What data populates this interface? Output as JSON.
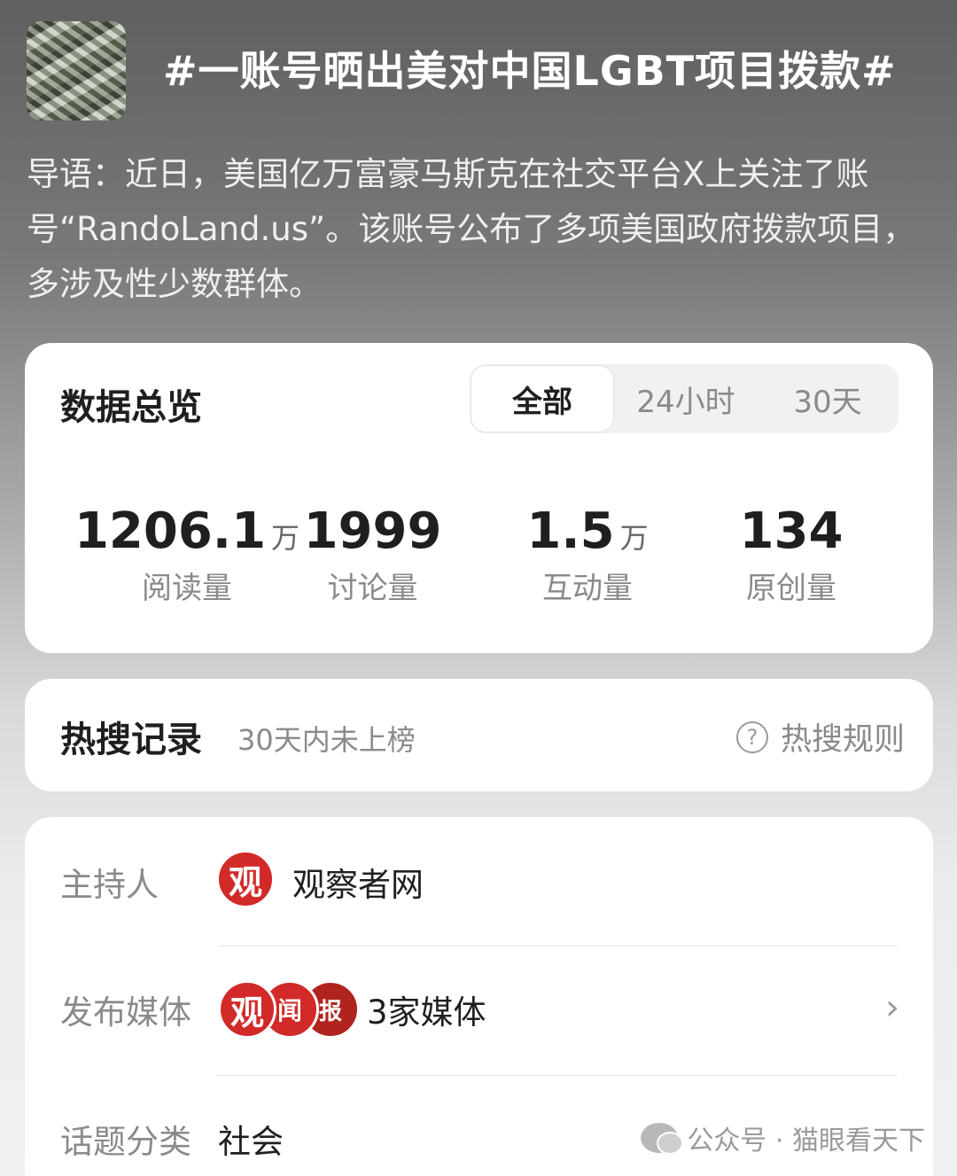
{
  "topic": {
    "title": "#一账号晒出美对中国LGBT项目拨款#",
    "intro": "导语：近日，美国亿万富豪马斯克在社交平台X上关注了账号“RandoLand.us”。该账号公布了多项美国政府拨款项目，多涉及性少数群体。"
  },
  "overview": {
    "title": "数据总览",
    "tabs": [
      "全部",
      "24小时",
      "30天"
    ],
    "active_tab": "全部",
    "stats": [
      {
        "value": "1206.1",
        "unit": "万",
        "label": "阅读量"
      },
      {
        "value": "1999",
        "unit": "",
        "label": "讨论量"
      },
      {
        "value": "1.5",
        "unit": "万",
        "label": "互动量"
      },
      {
        "value": "134",
        "unit": "",
        "label": "原创量"
      }
    ]
  },
  "hot_search": {
    "title": "热搜记录",
    "subtitle": "30天内未上榜",
    "rule_label": "热搜规则"
  },
  "info": {
    "host_label": "主持人",
    "host_name": "观察者网",
    "host_logo_char": "观",
    "media_label": "发布媒体",
    "media_count": "3家媒体",
    "media_logos": [
      "观",
      "闻",
      "报"
    ],
    "category_label": "话题分类",
    "category_value": "社会"
  },
  "watermark": {
    "text": "公众号 · 猫眼看天下"
  },
  "colors": {
    "accent_red": "#d12a28",
    "text_primary": "#1f1f1f",
    "text_secondary": "#8a8a8a"
  }
}
